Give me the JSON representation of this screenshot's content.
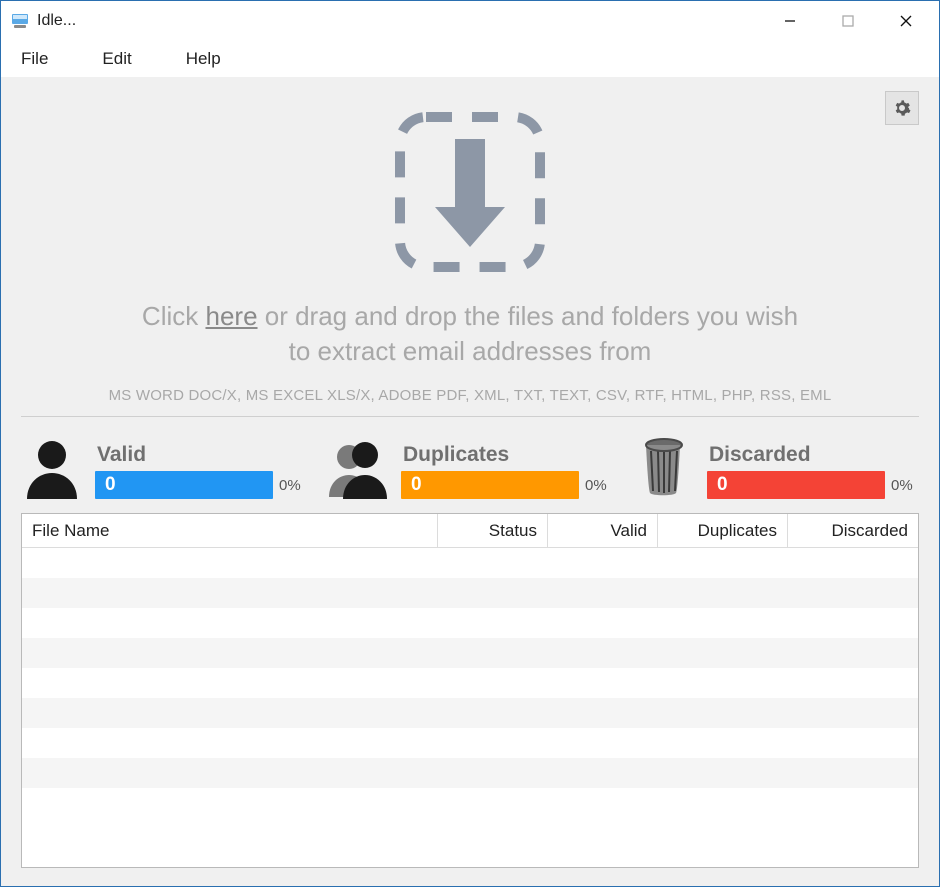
{
  "window": {
    "title": "Idle..."
  },
  "menu": {
    "file": "File",
    "edit": "Edit",
    "help": "Help"
  },
  "dropzone": {
    "instruction_pre": "Click ",
    "instruction_link": "here",
    "instruction_post_line1": " or drag and drop the files and folders you wish",
    "instruction_post_line2": "to extract email addresses from",
    "formats": "MS WORD DOC/X, MS EXCEL XLS/X, ADOBE PDF, XML, TXT, TEXT, CSV, RTF, HTML, PHP, RSS, EML"
  },
  "stats": {
    "valid": {
      "label": "Valid",
      "value": "0",
      "percent": "0%"
    },
    "duplicates": {
      "label": "Duplicates",
      "value": "0",
      "percent": "0%"
    },
    "discarded": {
      "label": "Discarded",
      "value": "0",
      "percent": "0%"
    }
  },
  "table": {
    "columns": {
      "filename": "File Name",
      "status": "Status",
      "valid": "Valid",
      "duplicates": "Duplicates",
      "discarded": "Discarded"
    }
  }
}
